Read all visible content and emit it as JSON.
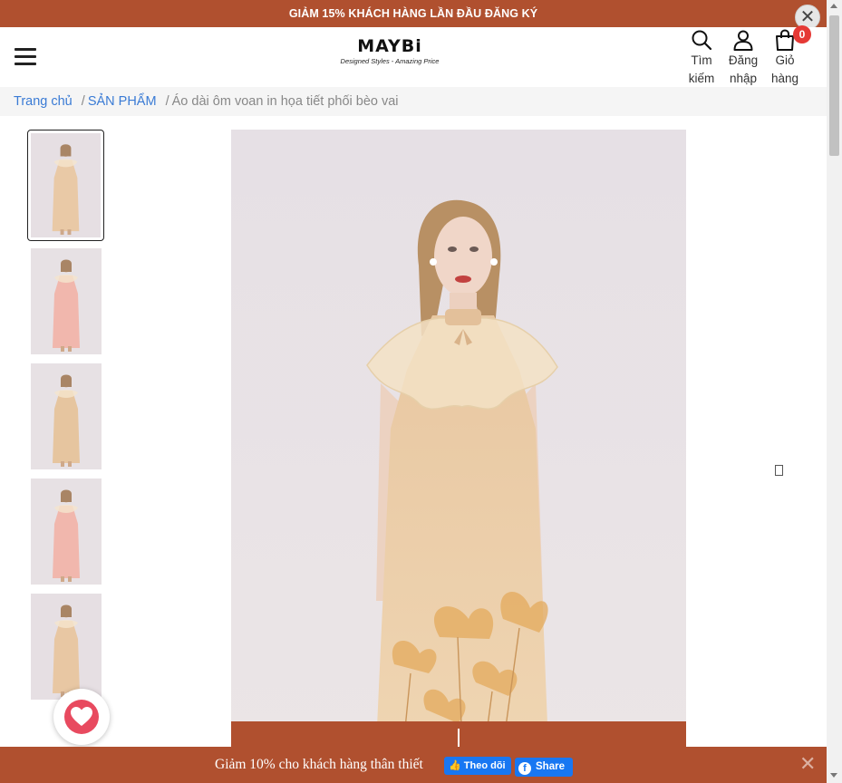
{
  "promo": {
    "text": "GIẢM 15% KHÁCH HÀNG LẦN ĐẦU ĐĂNG KÝ",
    "close_glyph": "✕"
  },
  "header": {
    "logo": {
      "word": "MAYBi",
      "tagline": "Designed Styles - Amazing Price"
    },
    "icons": [
      {
        "name": "search-icon",
        "label_line1": "Tìm",
        "label_line2": "kiếm"
      },
      {
        "name": "user-icon",
        "label_line1": "Đăng",
        "label_line2": "nhập"
      },
      {
        "name": "cart-icon",
        "label_line1": "Giỏ",
        "label_line2": "hàng"
      }
    ],
    "cart_count": "0"
  },
  "breadcrumb": {
    "home": "Trang chủ",
    "category": "SẢN PHẨM",
    "current": "Áo dài ôm voan in họa tiết phối bèo vai",
    "separator": "/"
  },
  "gallery": {
    "thumbnail_count": 5,
    "active_index": 0,
    "thumbnails": [
      {
        "dress_color": "#e9c9a6",
        "bg": "#e6dfe3"
      },
      {
        "dress_color": "#f1b7ad",
        "bg": "#e7e1e4"
      },
      {
        "dress_color": "#e6c59f",
        "bg": "#e7e1e4"
      },
      {
        "dress_color": "#f1b7ad",
        "bg": "#e7e1e4"
      },
      {
        "dress_color": "#e8c7a3",
        "bg": "#e6dfe3"
      }
    ]
  },
  "colors": {
    "brand": "#b0502f",
    "link": "#3a7bd5",
    "badge": "#e53935",
    "facebook": "#1877f2",
    "wishlist": "#e84a5f"
  },
  "bottom_bar": {
    "text": "Giảm 10% cho khách hàng thân thiết",
    "follow_label": "Theo dõi",
    "share_label": "Share",
    "share_glyph": "f",
    "close_glyph": "✕"
  }
}
